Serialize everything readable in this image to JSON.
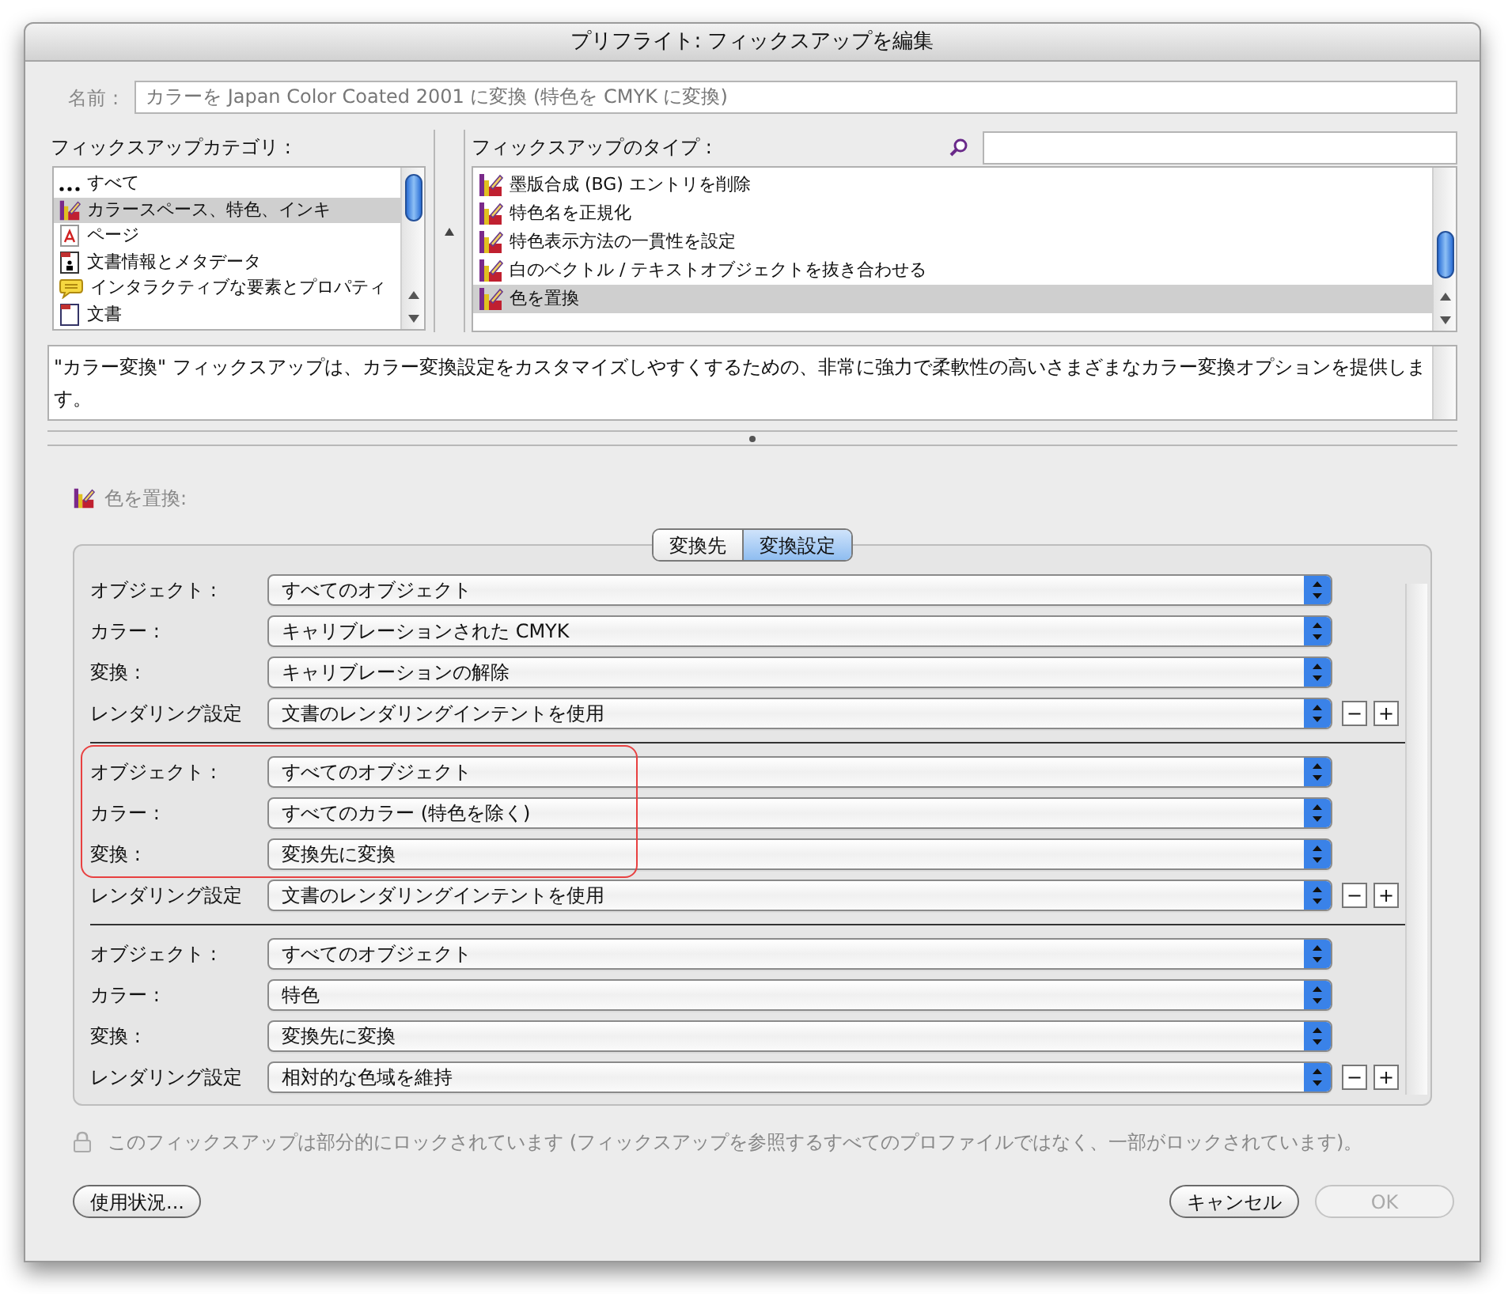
{
  "window": {
    "title": "プリフライト: フィックスアップを編集"
  },
  "name_field": {
    "label": "名前 :",
    "value": "カラーを Japan Color Coated 2001 に変換 (特色を CMYK に変換)"
  },
  "category_pane": {
    "label": "フィックスアップカテゴリ :",
    "items": [
      {
        "kind": "all",
        "label": "すべて",
        "selected": false
      },
      {
        "kind": "color",
        "label": "カラースペース、特色、インキ",
        "selected": true
      },
      {
        "kind": "page",
        "label": "ページ",
        "selected": false
      },
      {
        "kind": "metadata",
        "label": "文書情報とメタデータ",
        "selected": false
      },
      {
        "kind": "interactive",
        "label": "インタラクティブな要素とプロパティ",
        "selected": false
      },
      {
        "kind": "document",
        "label": "文書",
        "selected": false
      }
    ]
  },
  "type_pane": {
    "label": "フィックスアップのタイプ :",
    "items": [
      {
        "label": "墨版合成 (BG) エントリを削除",
        "selected": false
      },
      {
        "label": "特色名を正規化",
        "selected": false
      },
      {
        "label": "特色表示方法の一貫性を設定",
        "selected": false
      },
      {
        "label": "白のベクトル / テキストオブジェクトを抜き合わせる",
        "selected": false
      },
      {
        "label": "色を置換",
        "selected": true
      }
    ]
  },
  "description": "\"カラー変換\" フィックスアップは、カラー変換設定をカスタマイズしやすくするための、非常に強力で柔軟性の高いさまざまなカラー変換オプションを提供します。",
  "section": {
    "title": "色を置換:"
  },
  "tabs": [
    {
      "label": "変換先",
      "selected": false
    },
    {
      "label": "変換設定",
      "selected": true
    }
  ],
  "groups": [
    {
      "highlighted": false,
      "rows": [
        {
          "label": "オブジェクト :",
          "value": "すべてのオブジェクト"
        },
        {
          "label": "カラー :",
          "value": "キャリブレーションされた CMYK"
        },
        {
          "label": "変換 :",
          "value": "キャリブレーションの解除"
        },
        {
          "label": "レンダリング設定",
          "value": "文書のレンダリングインテントを使用"
        }
      ],
      "buttons": [
        "−",
        "+"
      ]
    },
    {
      "highlighted": true,
      "rows": [
        {
          "label": "オブジェクト :",
          "value": "すべてのオブジェクト"
        },
        {
          "label": "カラー :",
          "value": "すべてのカラー (特色を除く)"
        },
        {
          "label": "変換 :",
          "value": "変換先に変換"
        },
        {
          "label": "レンダリング設定",
          "value": "文書のレンダリングインテントを使用"
        }
      ],
      "buttons": [
        "−",
        "+"
      ]
    },
    {
      "highlighted": false,
      "rows": [
        {
          "label": "オブジェクト :",
          "value": "すべてのオブジェクト"
        },
        {
          "label": "カラー :",
          "value": "特色"
        },
        {
          "label": "変換 :",
          "value": "変換先に変換"
        },
        {
          "label": "レンダリング設定",
          "value": "相対的な色域を維持"
        }
      ],
      "buttons": [
        "−",
        "+"
      ]
    }
  ],
  "lock_note": "このフィックスアップは部分的にロックされています (フィックスアップを参照するすべてのプロファイルではなく、一部がロックされています)。",
  "buttons": [
    {
      "label": "使用状況...",
      "disabled": false
    },
    {
      "label": "キャンセル",
      "disabled": false
    },
    {
      "label": "OK",
      "disabled": true
    }
  ]
}
